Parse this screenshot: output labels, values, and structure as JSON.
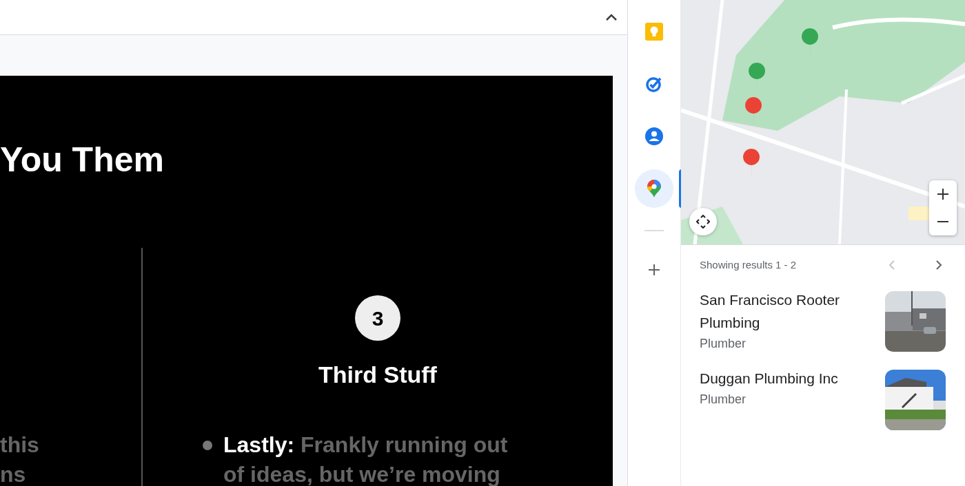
{
  "slide": {
    "title": "You Them",
    "left_column": {
      "lines": [
        "this",
        "ns"
      ]
    },
    "right_column": {
      "number": "3",
      "heading": "Third Stuff",
      "bullets": [
        {
          "text": "**Lastly:** Frankly running out of ideas, but we’re moving"
        }
      ]
    }
  },
  "side_apps": {
    "items": [
      {
        "kind": "keep",
        "selected": false
      },
      {
        "kind": "tasks",
        "selected": false
      },
      {
        "kind": "contacts",
        "selected": false
      },
      {
        "kind": "maps",
        "selected": true
      }
    ]
  },
  "maps_panel": {
    "summary": "Showing results 1 - 2",
    "prev_disabled": true,
    "results": [
      {
        "name": "San Francisco Rooter Plumbing",
        "category": "Plumber"
      },
      {
        "name": "Duggan Plumbing Inc",
        "category": "Plumber"
      }
    ]
  }
}
